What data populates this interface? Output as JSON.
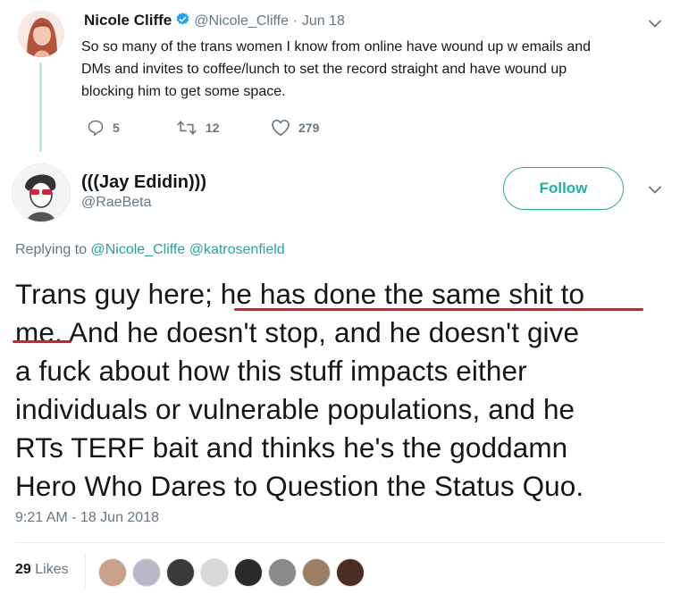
{
  "parent_tweet": {
    "author_name": "Nicole Cliffe",
    "author_handle": "@Nicole_Cliffe",
    "separator": "·",
    "date": "Jun 18",
    "text": "So so many of the trans women I know from online have wound up w emails and DMs and invites to coffee/lunch to set the record straight and have wound up blocking him to get some space.",
    "text_lines": [
      "So so many of the trans women I know from online have wound up w emails and",
      "DMs and invites to coffee/lunch to set the record straight and have wound up",
      "blocking him to get some space."
    ],
    "replies": "5",
    "retweets": "12",
    "likes": "279"
  },
  "main_tweet": {
    "author_name": "(((Jay Edidin)))",
    "author_handle": "@RaeBeta",
    "follow_label": "Follow",
    "replying_prefix": "Replying to",
    "replying_to": [
      "@Nicole_Cliffe",
      "@katrosenfield"
    ],
    "text_lines": [
      "Trans guy here; he has done the same shit to",
      "me. And he doesn't stop, and he doesn't give",
      "a fuck about how this stuff impacts either",
      "individuals or vulnerable populations, and he",
      "RTs TERF bait and thinks he's the goddamn",
      "Hero Who Dares to Question the Status Quo."
    ],
    "timestamp": "9:21 AM - 18 Jun 2018",
    "likes_count": "29",
    "likes_label": "Likes"
  },
  "colors": {
    "accent": "#1fb0a4",
    "verified": "#1da1f2",
    "muted": "#657786",
    "underline_annotation": "#d21f2e"
  },
  "icons": {
    "verified": "verified-badge-icon",
    "reply": "reply-icon",
    "retweet": "retweet-icon",
    "like": "heart-icon",
    "more": "chevron-down-icon"
  }
}
